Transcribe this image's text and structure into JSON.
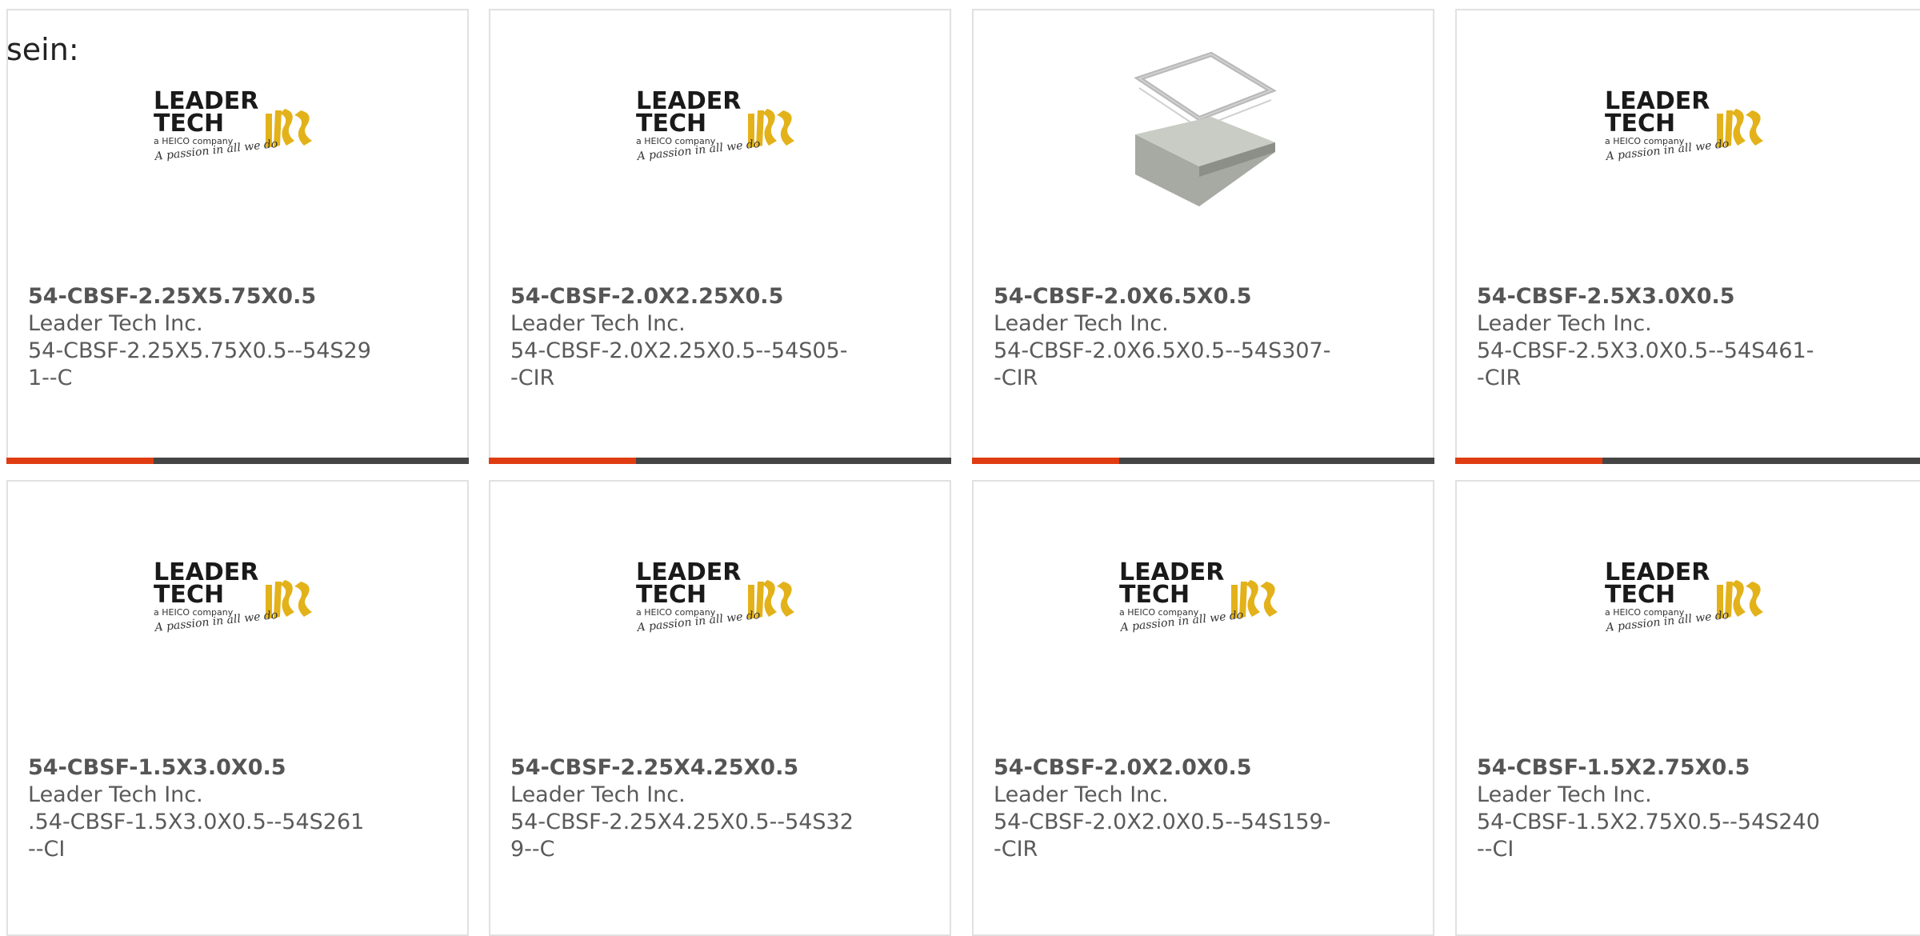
{
  "heading": "sein:",
  "colors": {
    "accent": "#e03c12",
    "bar": "#454545",
    "border": "#e1e1e1",
    "logo_gold": "#e3b21a"
  },
  "logo": {
    "line1": "LEADER",
    "line2": "TECH",
    "company": "a HEICO company",
    "tagline": "A passion in all we do"
  },
  "products": [
    {
      "title": "54-CBSF-2.25X5.75X0.5",
      "manufacturer": "Leader Tech Inc.",
      "part": "54-CBSF-2.25X5.75X0.5--54S291--C",
      "image": "leader-tech-logo"
    },
    {
      "title": "54-CBSF-2.0X2.25X0.5",
      "manufacturer": "Leader Tech Inc.",
      "part": "54-CBSF-2.0X2.25X0.5--54S05--CIR",
      "image": "leader-tech-logo"
    },
    {
      "title": "54-CBSF-2.0X6.5X0.5",
      "manufacturer": "Leader Tech Inc.",
      "part": "54-CBSF-2.0X6.5X0.5--54S307--CIR",
      "image": "shield-can-photo"
    },
    {
      "title": "54-CBSF-2.5X3.0X0.5",
      "manufacturer": "Leader Tech Inc.",
      "part": "54-CBSF-2.5X3.0X0.5--54S461--CIR",
      "image": "leader-tech-logo"
    },
    {
      "title": "54-CBSF-1.5X3.0X0.5",
      "manufacturer": "Leader Tech Inc.",
      "part": ".54-CBSF-1.5X3.0X0.5--54S261--CI",
      "image": "leader-tech-logo"
    },
    {
      "title": "54-CBSF-2.25X4.25X0.5",
      "manufacturer": "Leader Tech Inc.",
      "part": "54-CBSF-2.25X4.25X0.5--54S329--C",
      "image": "leader-tech-logo"
    },
    {
      "title": "54-CBSF-2.0X2.0X0.5",
      "manufacturer": "Leader Tech Inc.",
      "part": "54-CBSF-2.0X2.0X0.5--54S159--CIR",
      "image": "leader-tech-logo"
    },
    {
      "title": "54-CBSF-1.5X2.75X0.5",
      "manufacturer": "Leader Tech Inc.",
      "part": "54-CBSF-1.5X2.75X0.5--54S240--CI",
      "image": "leader-tech-logo"
    }
  ]
}
